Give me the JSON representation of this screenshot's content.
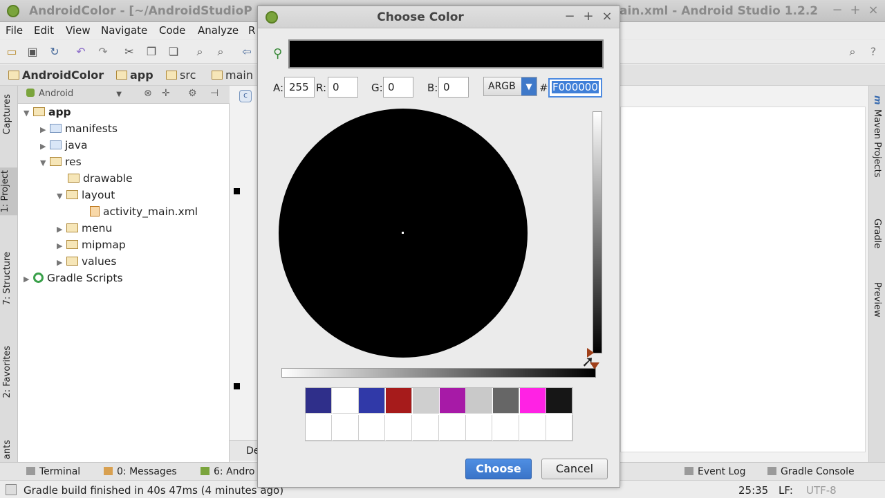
{
  "window": {
    "title_left": "AndroidColor - [~/AndroidStudioP",
    "title_right": "ain.xml - Android Studio 1.2.2"
  },
  "menu": [
    "File",
    "Edit",
    "View",
    "Navigate",
    "Code",
    "Analyze",
    "R"
  ],
  "breadcrumb": [
    "AndroidColor",
    "app",
    "src",
    "main"
  ],
  "project_panel": {
    "view_selector": "Android",
    "tree": [
      {
        "label": "app",
        "level": 0,
        "expanded": true,
        "bold": true
      },
      {
        "label": "manifests",
        "level": 1,
        "expanded": false
      },
      {
        "label": "java",
        "level": 1,
        "expanded": false
      },
      {
        "label": "res",
        "level": 1,
        "expanded": true
      },
      {
        "label": "drawable",
        "level": 2,
        "expanded": null
      },
      {
        "label": "layout",
        "level": 2,
        "expanded": true
      },
      {
        "label": "activity_main.xml",
        "level": 3,
        "expanded": null
      },
      {
        "label": "menu",
        "level": 2,
        "expanded": false
      },
      {
        "label": "mipmap",
        "level": 2,
        "expanded": false
      },
      {
        "label": "values",
        "level": 2,
        "expanded": false
      },
      {
        "label": "Gradle Scripts",
        "level": 0,
        "expanded": false
      }
    ]
  },
  "left_tabs": [
    "Captures",
    "1: Project",
    "7: Structure",
    "2: Favorites",
    "ants"
  ],
  "right_tabs": [
    "Maven Projects",
    "Gradle",
    "Preview"
  ],
  "editor_tab_fragment": "De",
  "bottom_tools": {
    "terminal": "Terminal",
    "messages": "0: Messages",
    "android": "6: Andro",
    "event_log": "Event Log",
    "gradle_console": "Gradle Console"
  },
  "status": {
    "message": "Gradle build finished in 40s 47ms (4 minutes ago)",
    "position": "25:35",
    "line_sep": "LF:",
    "encoding": "UTF-8"
  },
  "dialog": {
    "title": "Choose Color",
    "preview_color": "#000000",
    "fields": {
      "a_label": "A:",
      "a_value": "255",
      "r_label": "R:",
      "r_value": "0",
      "g_label": "G:",
      "g_value": "0",
      "b_label": "B:",
      "b_value": "0"
    },
    "mode": "ARGB",
    "hash_label": "#",
    "hex_value": "F000000",
    "swatches_recent": [
      "#2f2f8a",
      "#ffffff",
      "#3039a8",
      "#a61b1b",
      "#cfcfcf",
      "#a71aa7",
      "#c9c9c9",
      "#666666",
      "#ff22e4",
      "#161616"
    ],
    "choose_label": "Choose",
    "cancel_label": "Cancel"
  }
}
